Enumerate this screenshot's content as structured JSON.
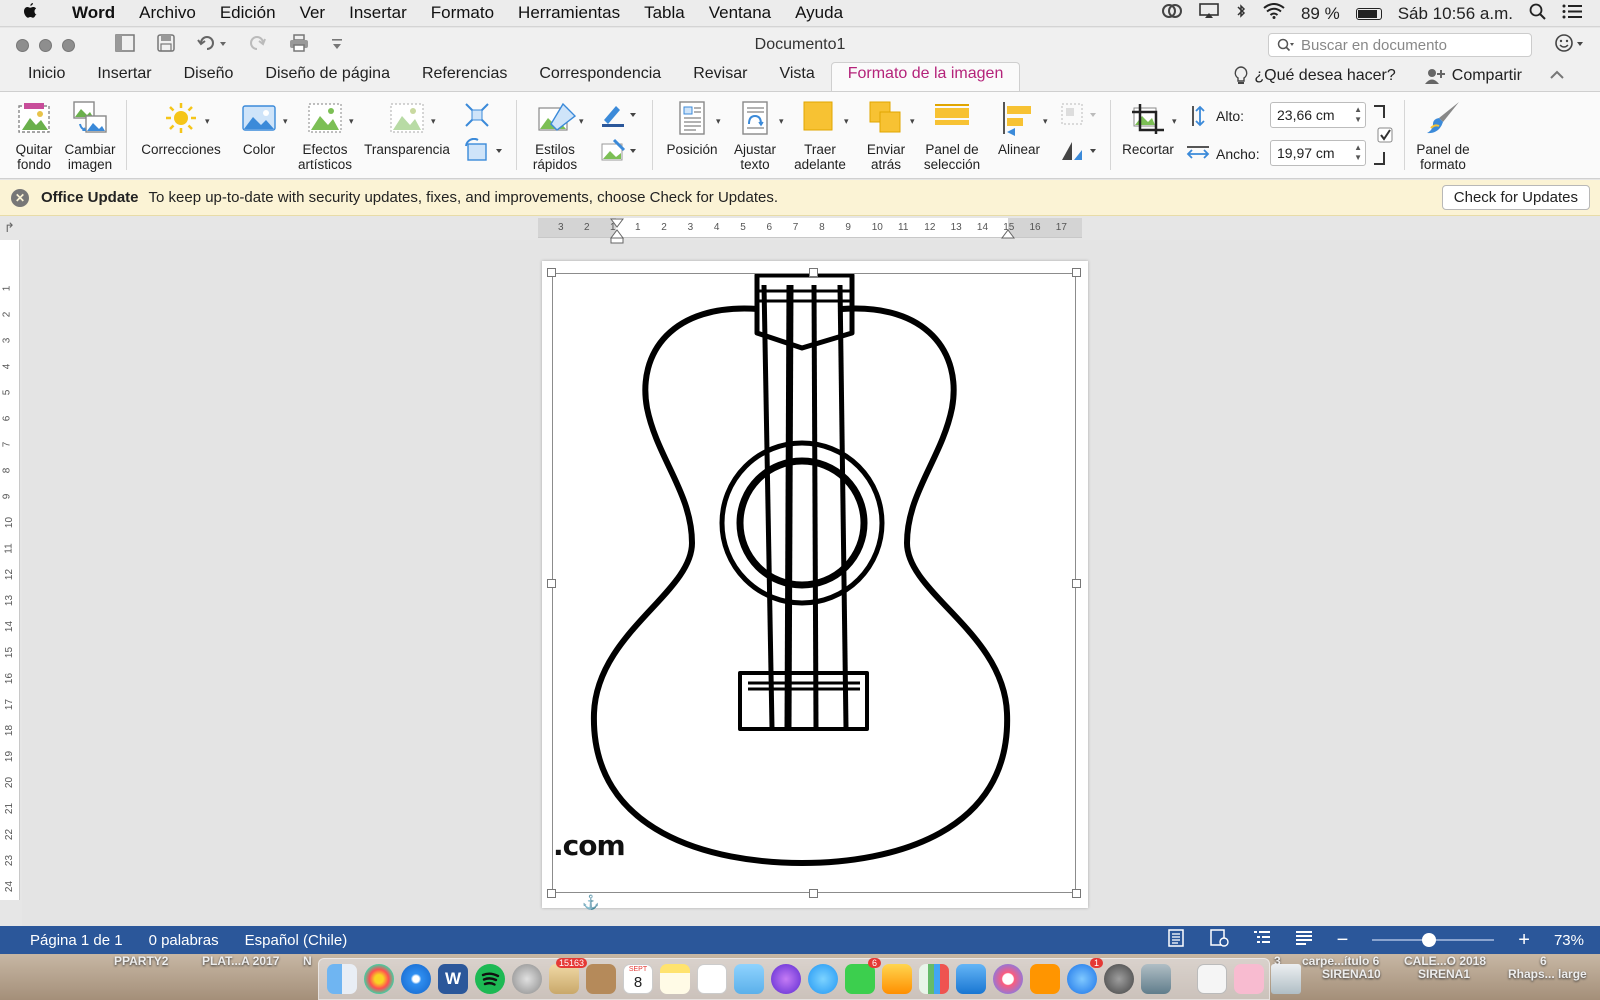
{
  "menubar": {
    "app_name": "Word",
    "menus": [
      "Archivo",
      "Edición",
      "Ver",
      "Insertar",
      "Formato",
      "Herramientas",
      "Tabla",
      "Ventana",
      "Ayuda"
    ],
    "battery": "89 %",
    "battery_level": 0.89,
    "clock": "Sáb 10:56 a.m."
  },
  "window": {
    "title": "Documento1",
    "search_placeholder": "Buscar en documento"
  },
  "tabs": {
    "items": [
      "Inicio",
      "Insertar",
      "Diseño",
      "Diseño de página",
      "Referencias",
      "Correspondencia",
      "Revisar",
      "Vista",
      "Formato de la imagen"
    ],
    "active": "Formato de la imagen",
    "help": "¿Qué desea hacer?",
    "share": "Compartir"
  },
  "ribbon": {
    "quitar_fondo": [
      "Quitar",
      "fondo"
    ],
    "cambiar_imagen": [
      "Cambiar",
      "imagen"
    ],
    "correcciones": "Correcciones",
    "color": "Color",
    "efectos": [
      "Efectos",
      "artísticos"
    ],
    "transparencia": "Transparencia",
    "estilos": [
      "Estilos",
      "rápidos"
    ],
    "posicion": "Posición",
    "ajustar": [
      "Ajustar",
      "texto"
    ],
    "traer": [
      "Traer",
      "adelante"
    ],
    "enviar": [
      "Enviar",
      "atrás"
    ],
    "panel_seleccion": [
      "Panel de",
      "selección"
    ],
    "alinear": "Alinear",
    "recortar": "Recortar",
    "alto_label": "Alto:",
    "alto_value": "23,66 cm",
    "ancho_label": "Ancho:",
    "ancho_value": "19,97 cm",
    "panel_formato": [
      "Panel de",
      "formato"
    ]
  },
  "update_bar": {
    "title": "Office Update",
    "message": "To keep up-to-date with security updates, fixes, and improvements, choose Check for Updates.",
    "button": "Check for Updates"
  },
  "rulers": {
    "horizontal": [
      "3",
      "2",
      "1",
      "1",
      "2",
      "3",
      "4",
      "5",
      "6",
      "7",
      "8",
      "9",
      "10",
      "11",
      "12",
      "13",
      "14",
      "15",
      "16",
      "17"
    ],
    "vertical": [
      "1",
      "2",
      "3",
      "4",
      "5",
      "6",
      "7",
      "8",
      "9",
      "10",
      "11",
      "12",
      "13",
      "14",
      "15",
      "16",
      "17",
      "18",
      "19",
      "20",
      "21",
      "22",
      "23",
      "24"
    ]
  },
  "document": {
    "image_caption": ".com"
  },
  "statusbar": {
    "page": "Página 1 de 1",
    "words": "0 palabras",
    "language": "Español (Chile)",
    "zoom": "73%",
    "zoom_fraction": 0.73
  },
  "desktop": {
    "labels": [
      "PPARTY2",
      "PLAT...A 2017",
      "N",
      "3",
      "carpe...ítulo 6",
      "SIRENA10",
      "CALE...O 2018",
      "SIRENA1",
      "6",
      "Rhaps... large"
    ]
  },
  "dock": {
    "mail_badge": "15163",
    "calendar_month": "SEPT",
    "calendar_day": "8",
    "facetime_badge": "6",
    "appstore_badge": "1"
  },
  "colors": {
    "accent_tab": "#b4237a",
    "statusbar": "#2b579a",
    "update_bar": "#fbf3d5"
  }
}
